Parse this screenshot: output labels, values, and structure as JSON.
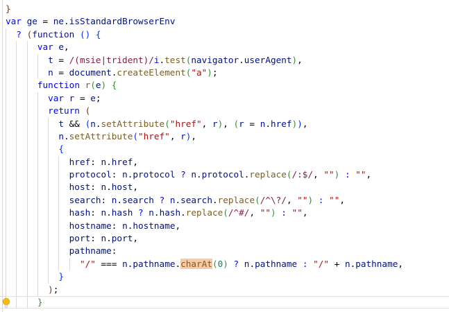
{
  "editor": {
    "background": "#ffffff",
    "gutter_border_color": "#d9d9d9",
    "indent_guide_color": "#d9d9d9",
    "current_line_border_color": "#e2e2e2",
    "find_match_highlight_color": "#f8c9a3",
    "highlighted_word": "charAt",
    "current_line": 24,
    "lightbulb": {
      "icon": "lightbulb-icon",
      "line": 24,
      "color": "#f6bb18"
    },
    "token_colors": {
      "kw": "#0000ff",
      "op": "#0000ff",
      "v": "#001080",
      "p": "#000000",
      "s": "#a31515",
      "re": "#811f3f",
      "flag": "#0000ff",
      "fn": "#795e26",
      "num": "#098658",
      "b1": "#0431fa",
      "b2": "#319331",
      "b3": "#7b3814"
    },
    "lines": [
      {
        "indent": 0,
        "tokens": [
          [
            "b3",
            "}"
          ]
        ]
      },
      {
        "indent": 0,
        "tokens": [
          [
            "kw",
            "var"
          ],
          [
            "p",
            " "
          ],
          [
            "v",
            "ge"
          ],
          [
            "p",
            " = "
          ],
          [
            "v",
            "ne"
          ],
          [
            "p",
            "."
          ],
          [
            "v",
            "isStandardBrowserEnv"
          ]
        ]
      },
      {
        "indent": 2,
        "tokens": [
          [
            "op",
            "?"
          ],
          [
            "p",
            " "
          ],
          [
            "b3",
            "("
          ],
          [
            "kw",
            "function"
          ],
          [
            "p",
            " "
          ],
          [
            "b1",
            "()"
          ],
          [
            "p",
            " "
          ],
          [
            "b1",
            "{"
          ]
        ]
      },
      {
        "indent": 6,
        "tokens": [
          [
            "kw",
            "var"
          ],
          [
            "p",
            " "
          ],
          [
            "v",
            "e"
          ],
          [
            "p",
            ","
          ]
        ]
      },
      {
        "indent": 8,
        "tokens": [
          [
            "v",
            "t"
          ],
          [
            "p",
            " = "
          ],
          [
            "re",
            "/(msie|trident)/"
          ],
          [
            "flag",
            "i"
          ],
          [
            "p",
            "."
          ],
          [
            "fn",
            "test"
          ],
          [
            "b2",
            "("
          ],
          [
            "v",
            "navigator"
          ],
          [
            "p",
            "."
          ],
          [
            "v",
            "userAgent"
          ],
          [
            "b2",
            ")"
          ],
          [
            "p",
            ","
          ]
        ]
      },
      {
        "indent": 8,
        "tokens": [
          [
            "v",
            "n"
          ],
          [
            "p",
            " = "
          ],
          [
            "v",
            "document"
          ],
          [
            "p",
            "."
          ],
          [
            "fn",
            "createElement"
          ],
          [
            "b2",
            "("
          ],
          [
            "s",
            "\"a\""
          ],
          [
            "b2",
            ")"
          ],
          [
            "p",
            ";"
          ]
        ]
      },
      {
        "indent": 6,
        "tokens": [
          [
            "kw",
            "function"
          ],
          [
            "p",
            " "
          ],
          [
            "fn",
            "r"
          ],
          [
            "b2",
            "("
          ],
          [
            "v",
            "e"
          ],
          [
            "b2",
            ")"
          ],
          [
            "p",
            " "
          ],
          [
            "b2",
            "{"
          ]
        ]
      },
      {
        "indent": 8,
        "tokens": [
          [
            "kw",
            "var"
          ],
          [
            "p",
            " "
          ],
          [
            "v",
            "r"
          ],
          [
            "p",
            " = "
          ],
          [
            "v",
            "e"
          ],
          [
            "p",
            ";"
          ]
        ]
      },
      {
        "indent": 8,
        "tokens": [
          [
            "kw",
            "return"
          ],
          [
            "p",
            " "
          ],
          [
            "b3",
            "("
          ]
        ]
      },
      {
        "indent": 10,
        "tokens": [
          [
            "v",
            "t"
          ],
          [
            "p",
            " && "
          ],
          [
            "b1",
            "("
          ],
          [
            "v",
            "n"
          ],
          [
            "p",
            "."
          ],
          [
            "fn",
            "setAttribute"
          ],
          [
            "b2",
            "("
          ],
          [
            "s",
            "\"href\""
          ],
          [
            "p",
            ", "
          ],
          [
            "v",
            "r"
          ],
          [
            "b2",
            ")"
          ],
          [
            "p",
            ", "
          ],
          [
            "b2",
            "("
          ],
          [
            "v",
            "r"
          ],
          [
            "p",
            " = "
          ],
          [
            "v",
            "n"
          ],
          [
            "p",
            "."
          ],
          [
            "v",
            "href"
          ],
          [
            "b2",
            ")"
          ],
          [
            "b1",
            ")"
          ],
          [
            "p",
            ","
          ]
        ]
      },
      {
        "indent": 10,
        "tokens": [
          [
            "v",
            "n"
          ],
          [
            "p",
            "."
          ],
          [
            "fn",
            "setAttribute"
          ],
          [
            "b1",
            "("
          ],
          [
            "s",
            "\"href\""
          ],
          [
            "p",
            ", "
          ],
          [
            "v",
            "r"
          ],
          [
            "b1",
            ")"
          ],
          [
            "p",
            ","
          ]
        ]
      },
      {
        "indent": 10,
        "tokens": [
          [
            "b1",
            "{"
          ]
        ]
      },
      {
        "indent": 12,
        "tokens": [
          [
            "v",
            "href"
          ],
          [
            "p",
            ": "
          ],
          [
            "v",
            "n"
          ],
          [
            "p",
            "."
          ],
          [
            "v",
            "href"
          ],
          [
            "p",
            ","
          ]
        ]
      },
      {
        "indent": 12,
        "tokens": [
          [
            "v",
            "protocol"
          ],
          [
            "p",
            ": "
          ],
          [
            "v",
            "n"
          ],
          [
            "p",
            "."
          ],
          [
            "v",
            "protocol"
          ],
          [
            "p",
            " "
          ],
          [
            "op",
            "?"
          ],
          [
            "p",
            " "
          ],
          [
            "v",
            "n"
          ],
          [
            "p",
            "."
          ],
          [
            "v",
            "protocol"
          ],
          [
            "p",
            "."
          ],
          [
            "fn",
            "replace"
          ],
          [
            "b2",
            "("
          ],
          [
            "re",
            "/:$/"
          ],
          [
            "p",
            ", "
          ],
          [
            "s",
            "\"\""
          ],
          [
            "b2",
            ")"
          ],
          [
            "p",
            " "
          ],
          [
            "op",
            ":"
          ],
          [
            "p",
            " "
          ],
          [
            "s",
            "\"\""
          ],
          [
            "p",
            ","
          ]
        ]
      },
      {
        "indent": 12,
        "tokens": [
          [
            "v",
            "host"
          ],
          [
            "p",
            ": "
          ],
          [
            "v",
            "n"
          ],
          [
            "p",
            "."
          ],
          [
            "v",
            "host"
          ],
          [
            "p",
            ","
          ]
        ]
      },
      {
        "indent": 12,
        "tokens": [
          [
            "v",
            "search"
          ],
          [
            "p",
            ": "
          ],
          [
            "v",
            "n"
          ],
          [
            "p",
            "."
          ],
          [
            "v",
            "search"
          ],
          [
            "p",
            " "
          ],
          [
            "op",
            "?"
          ],
          [
            "p",
            " "
          ],
          [
            "v",
            "n"
          ],
          [
            "p",
            "."
          ],
          [
            "v",
            "search"
          ],
          [
            "p",
            "."
          ],
          [
            "fn",
            "replace"
          ],
          [
            "b2",
            "("
          ],
          [
            "re",
            "/^\\?/"
          ],
          [
            "p",
            ", "
          ],
          [
            "s",
            "\"\""
          ],
          [
            "b2",
            ")"
          ],
          [
            "p",
            " "
          ],
          [
            "op",
            ":"
          ],
          [
            "p",
            " "
          ],
          [
            "s",
            "\"\""
          ],
          [
            "p",
            ","
          ]
        ]
      },
      {
        "indent": 12,
        "tokens": [
          [
            "v",
            "hash"
          ],
          [
            "p",
            ": "
          ],
          [
            "v",
            "n"
          ],
          [
            "p",
            "."
          ],
          [
            "v",
            "hash"
          ],
          [
            "p",
            " "
          ],
          [
            "op",
            "?"
          ],
          [
            "p",
            " "
          ],
          [
            "v",
            "n"
          ],
          [
            "p",
            "."
          ],
          [
            "v",
            "hash"
          ],
          [
            "p",
            "."
          ],
          [
            "fn",
            "replace"
          ],
          [
            "b2",
            "("
          ],
          [
            "re",
            "/^#/"
          ],
          [
            "p",
            ", "
          ],
          [
            "s",
            "\"\""
          ],
          [
            "b2",
            ")"
          ],
          [
            "p",
            " "
          ],
          [
            "op",
            ":"
          ],
          [
            "p",
            " "
          ],
          [
            "s",
            "\"\""
          ],
          [
            "p",
            ","
          ]
        ]
      },
      {
        "indent": 12,
        "tokens": [
          [
            "v",
            "hostname"
          ],
          [
            "p",
            ": "
          ],
          [
            "v",
            "n"
          ],
          [
            "p",
            "."
          ],
          [
            "v",
            "hostname"
          ],
          [
            "p",
            ","
          ]
        ]
      },
      {
        "indent": 12,
        "tokens": [
          [
            "v",
            "port"
          ],
          [
            "p",
            ": "
          ],
          [
            "v",
            "n"
          ],
          [
            "p",
            "."
          ],
          [
            "v",
            "port"
          ],
          [
            "p",
            ","
          ]
        ]
      },
      {
        "indent": 12,
        "tokens": [
          [
            "v",
            "pathname"
          ],
          [
            "p",
            ":"
          ]
        ]
      },
      {
        "indent": 14,
        "tokens": [
          [
            "s",
            "\"/\""
          ],
          [
            "p",
            " === "
          ],
          [
            "v",
            "n"
          ],
          [
            "p",
            "."
          ],
          [
            "v",
            "pathname"
          ],
          [
            "p",
            "."
          ],
          [
            "fn",
            "charAt",
            "hl"
          ],
          [
            "b2",
            "("
          ],
          [
            "num",
            "0"
          ],
          [
            "b2",
            ")"
          ],
          [
            "p",
            " "
          ],
          [
            "op",
            "?"
          ],
          [
            "p",
            " "
          ],
          [
            "v",
            "n"
          ],
          [
            "p",
            "."
          ],
          [
            "v",
            "pathname"
          ],
          [
            "p",
            " "
          ],
          [
            "op",
            ":"
          ],
          [
            "p",
            " "
          ],
          [
            "s",
            "\"/\""
          ],
          [
            "p",
            " + "
          ],
          [
            "v",
            "n"
          ],
          [
            "p",
            "."
          ],
          [
            "v",
            "pathname"
          ],
          [
            "p",
            ","
          ]
        ]
      },
      {
        "indent": 10,
        "tokens": [
          [
            "b1",
            "}"
          ]
        ]
      },
      {
        "indent": 8,
        "tokens": [
          [
            "b3",
            ")"
          ],
          [
            "p",
            ";"
          ]
        ]
      },
      {
        "indent": 6,
        "tokens": [
          [
            "b2",
            "}"
          ]
        ]
      }
    ]
  }
}
